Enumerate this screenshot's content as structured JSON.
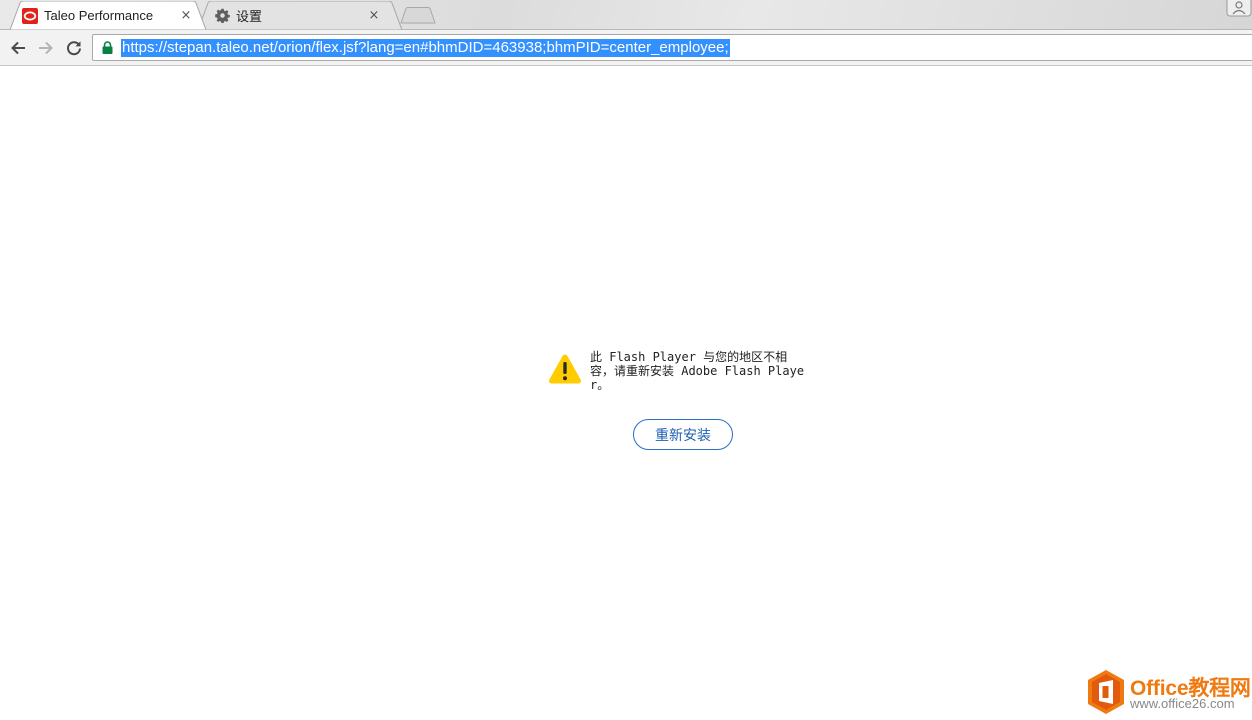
{
  "browser": {
    "tabs": [
      {
        "title": "Taleo Performance",
        "favicon": "oracle-logo-icon",
        "active": true
      },
      {
        "title": "设置",
        "favicon": "gear-icon",
        "active": false
      }
    ],
    "new_tab_icon": "new-tab-icon",
    "close_icon": "×",
    "address_bar": {
      "url": "https://stepan.taleo.net/orion/flex.jsf?lang=en#bhmDID=463938;bhmPID=center_employee;",
      "secure": true,
      "selected": true
    }
  },
  "page": {
    "notice": {
      "icon": "warning-icon",
      "text": "此 Flash Player 与您的地区不相容，请重新安装 Adobe Flash Player。"
    },
    "reinstall_button": "重新安装"
  },
  "watermark": {
    "brand": "Office教程网",
    "url": "www.office26.com"
  },
  "colors": {
    "selection": "#3390ff",
    "button_border": "#2a6fc4",
    "warning": "#ffcc00",
    "watermark_orange": "#f07a12"
  }
}
